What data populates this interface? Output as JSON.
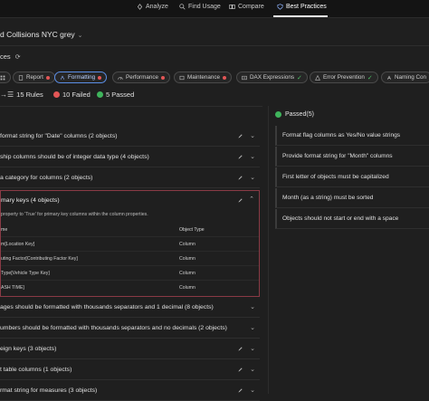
{
  "nav": {
    "items": [
      {
        "label": "Analyze",
        "icon": "analyze-icon"
      },
      {
        "label": "Find Usage",
        "icon": "search-icon"
      },
      {
        "label": "Compare",
        "icon": "compare-icon"
      },
      {
        "label": "Best Practices",
        "icon": "shield-icon",
        "active": true
      }
    ]
  },
  "model": {
    "title": "d Collisions NYC grey"
  },
  "section": {
    "label": "ces"
  },
  "chips": [
    {
      "label": "Report",
      "status": "fail"
    },
    {
      "label": "Formatting",
      "status": "fail",
      "active": true
    },
    {
      "label": "Performance",
      "status": "fail"
    },
    {
      "label": "Maintenance",
      "status": "fail"
    },
    {
      "label": "DAX Expressions",
      "status": "pass"
    },
    {
      "label": "Error Prevention",
      "status": "pass"
    },
    {
      "label": "Naming Con",
      "status": "none"
    }
  ],
  "stats": {
    "rules": "15 Rules",
    "failed": "10 Failed",
    "passed": "5 Passed"
  },
  "failed_rules": [
    {
      "text": "format string for \"Date\" columns (2 objects)"
    },
    {
      "text": "ship columns should be of integer data type (4 objects)"
    },
    {
      "text": "a category for columns (2 objects)"
    }
  ],
  "expanded_rule": {
    "title": "mary keys (4 objects)",
    "description": "property to 'True' for primary key columns within the column properties.",
    "col_name": "me",
    "col_type": "Object Type",
    "rows": [
      {
        "name": "m[Location Key]",
        "type": "Column"
      },
      {
        "name": "uting Factor[Contributing Factor Key]",
        "type": "Column"
      },
      {
        "name": "Type[Vehicle Type Key]",
        "type": "Column"
      },
      {
        "name": "ASH TIME]",
        "type": "Column"
      }
    ]
  },
  "more_rules": [
    {
      "text": "ages should be formatted with thousands separators and 1 decimal (8 objects)"
    },
    {
      "text": "umbers should be formatted with thousands separators and no decimals (2 objects)"
    },
    {
      "text": "eign keys (3 objects)"
    },
    {
      "text": "t table columns (1 objects)"
    },
    {
      "text": "rmat string for measures (3 objects)"
    }
  ],
  "passed": {
    "label": "Passed",
    "count": "(5)",
    "items": [
      "Format flag columns as Yes/No value strings",
      "Provide format string for \"Month\" columns",
      "First letter of objects must be capitalized",
      "Month (as a string) must be sorted",
      "Objects should not start or end with a space"
    ]
  },
  "colors": {
    "background": "#1f1f1f",
    "fail": "#e35656",
    "pass": "#3fb45c",
    "accent": "#5b8ee6",
    "expanded_border": "#8a3a45"
  }
}
